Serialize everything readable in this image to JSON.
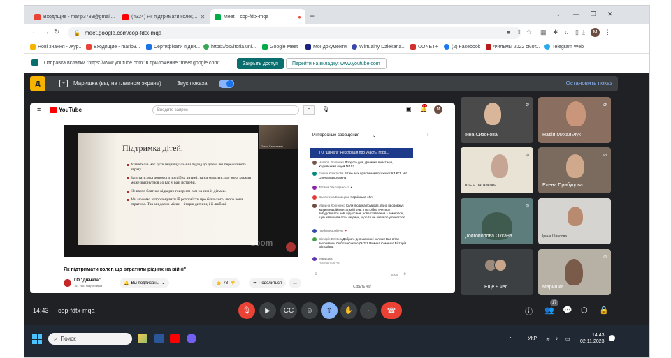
{
  "browser": {
    "tabs": [
      {
        "label": "Входящие - marip3789@gmail...",
        "color": "#ea4335"
      },
      {
        "label": "(4324) Як підтримати колег,...",
        "color": "#ff0000"
      },
      {
        "label": "Meet – cop-fdtx-mqa",
        "color": "#00ac47"
      }
    ],
    "new_tab": "+",
    "url": "meet.google.com/cop-fdtx-mqa",
    "profile_initial": "M"
  },
  "bookmarks": [
    {
      "label": "Нові знання - Жур...",
      "color": "#f6b400"
    },
    {
      "label": "Входящие - marip3...",
      "color": "#ea4335"
    },
    {
      "label": "Сертифікати підви...",
      "color": "#1a73e8"
    },
    {
      "label": "https://osvitoria.uni...",
      "color": "#34a853"
    },
    {
      "label": "Google Meet",
      "color": "#00ac47"
    },
    {
      "label": "Мої документи",
      "color": "#1a237e"
    },
    {
      "label": "Wirtualny Dziekana...",
      "color": "#3949ab"
    },
    {
      "label": "UONET+",
      "color": "#d32f2f"
    },
    {
      "label": "(2) Facebook",
      "color": "#1877f2"
    },
    {
      "label": "Фильмы 2022 смот...",
      "color": "#b71c1c"
    },
    {
      "label": "Telegram Web",
      "color": "#29a9eb"
    }
  ],
  "infobar": {
    "message": "Отправка вкладки \"https://www.youtube.com\" в приложение \"meet.google.com\"...",
    "share_button": "Закрыть доступ",
    "goto_button": "Перейти на вкладку: www.youtube.com"
  },
  "presentation": {
    "logo_letter": "Д",
    "presenter": "Маришка (вы, на главном экране)",
    "sound_label": "Звук показа",
    "stop_label": "Остановить показ"
  },
  "youtube": {
    "logo": "YouTube",
    "search_placeholder": "Введите запрос",
    "video_title": "Як підтримати колег, що втратили рідних на війні\"",
    "channel": "ГО \"Дівчата\"",
    "subscribers": "161 тыс. подписчиков",
    "subscribe_label": "Вы подписаны",
    "likes": "78",
    "share_label": "Поделиться",
    "notification_count": "9+",
    "zoom_watermark": "zoom",
    "slide": {
      "title": "Підтримка дітей.",
      "bullets": [
        "У вчителів має бути індивідуальний підхід до дітей, які переживають втрату.",
        "Запитати, яка допомога потрібна дитині, та наголосити, що вона завжди може звернутися до вас у разі потреби.",
        "Не варто боятися відверто говорити сам на сам із дітьми.",
        "Ми можемо запропонувати їй розповісти про близького, якого вона втратила. Так ми даємо місце – і горю дитини, і її любові."
      ],
      "cam_name": "Ольга Капилевич"
    },
    "chat": {
      "header": "Интересные сообщения",
      "pinned": "ГО \"Дівчата\"  Реєстрація про участь: https...",
      "messages": [
        {
          "name": "Наталя Яковенко",
          "text": "Доброго дня, Дячинко Анастасія, Харківський ліцей №152",
          "color": "#795548"
        },
        {
          "name": "Елена Кочеткова",
          "text": "Вітаю всіх практичний психолог КЗ КГЛ №3 Олена Миколаївна",
          "color": "#00897b"
        },
        {
          "name": "Тетяна Звьозданська",
          "text": "",
          "color": "#8e24aa"
        },
        {
          "name": "Валентина Бравцова",
          "text": "Харківська обл",
          "color": "#e53935"
        },
        {
          "name": "Марина Корнієнко",
          "text": "Коли людина помирає, вона продовжує жити в нашій ментальній уяві. І потрібно вчитися вибудовувати нові відносини, нове ставлення з померлою, щоб залишити стан людини, щоб то не вигляло у почестою",
          "color": "#6d4c41"
        },
        {
          "name": "Любов Корнійчук",
          "text": "",
          "color": "#3949ab"
        },
        {
          "name": "Вікторія Еліївна",
          "text": "Доброго дня шановні колеги! Вас вітає вихователь Люботинського ДНЗ 1 Яхмина Семенко Вікторія Вікторівна",
          "color": "#43a047"
        },
        {
          "name": "Маришка",
          "text": "Напишіть в чат",
          "color": "#5e35b1"
        }
      ],
      "char_counter": "0/200",
      "footer": "Скрыть чат"
    }
  },
  "participants": [
    {
      "name": "Інна Сизонова",
      "muted": true,
      "bg": "#4a4a4a"
    },
    {
      "name": "Надія Михальчук",
      "muted": true,
      "bg": "#8a6e60"
    },
    {
      "name": "ольга ратникова",
      "muted": true,
      "bg": "#e9e3d6"
    },
    {
      "name": "Елена Прибудова",
      "muted": true,
      "bg": "#7a6b5e"
    },
    {
      "name": "Долгополова Оксана",
      "muted": true,
      "bg": "#5d7d7c"
    },
    {
      "name": "Ірина Швалова",
      "muted": false,
      "bg": "#d6d4d0"
    },
    {
      "name": "Ещё 9 чел.",
      "muted": false,
      "bg": "#3c4043"
    },
    {
      "name": "Маришка",
      "muted": true,
      "bg": "#b7b0a5"
    }
  ],
  "meet_bar": {
    "time": "14:43",
    "code": "cop-fdtx-mqa",
    "people_count": "17"
  },
  "taskbar": {
    "search_label": "Поиск",
    "language": "УКР",
    "time": "14:43",
    "date": "02.11.2023"
  }
}
